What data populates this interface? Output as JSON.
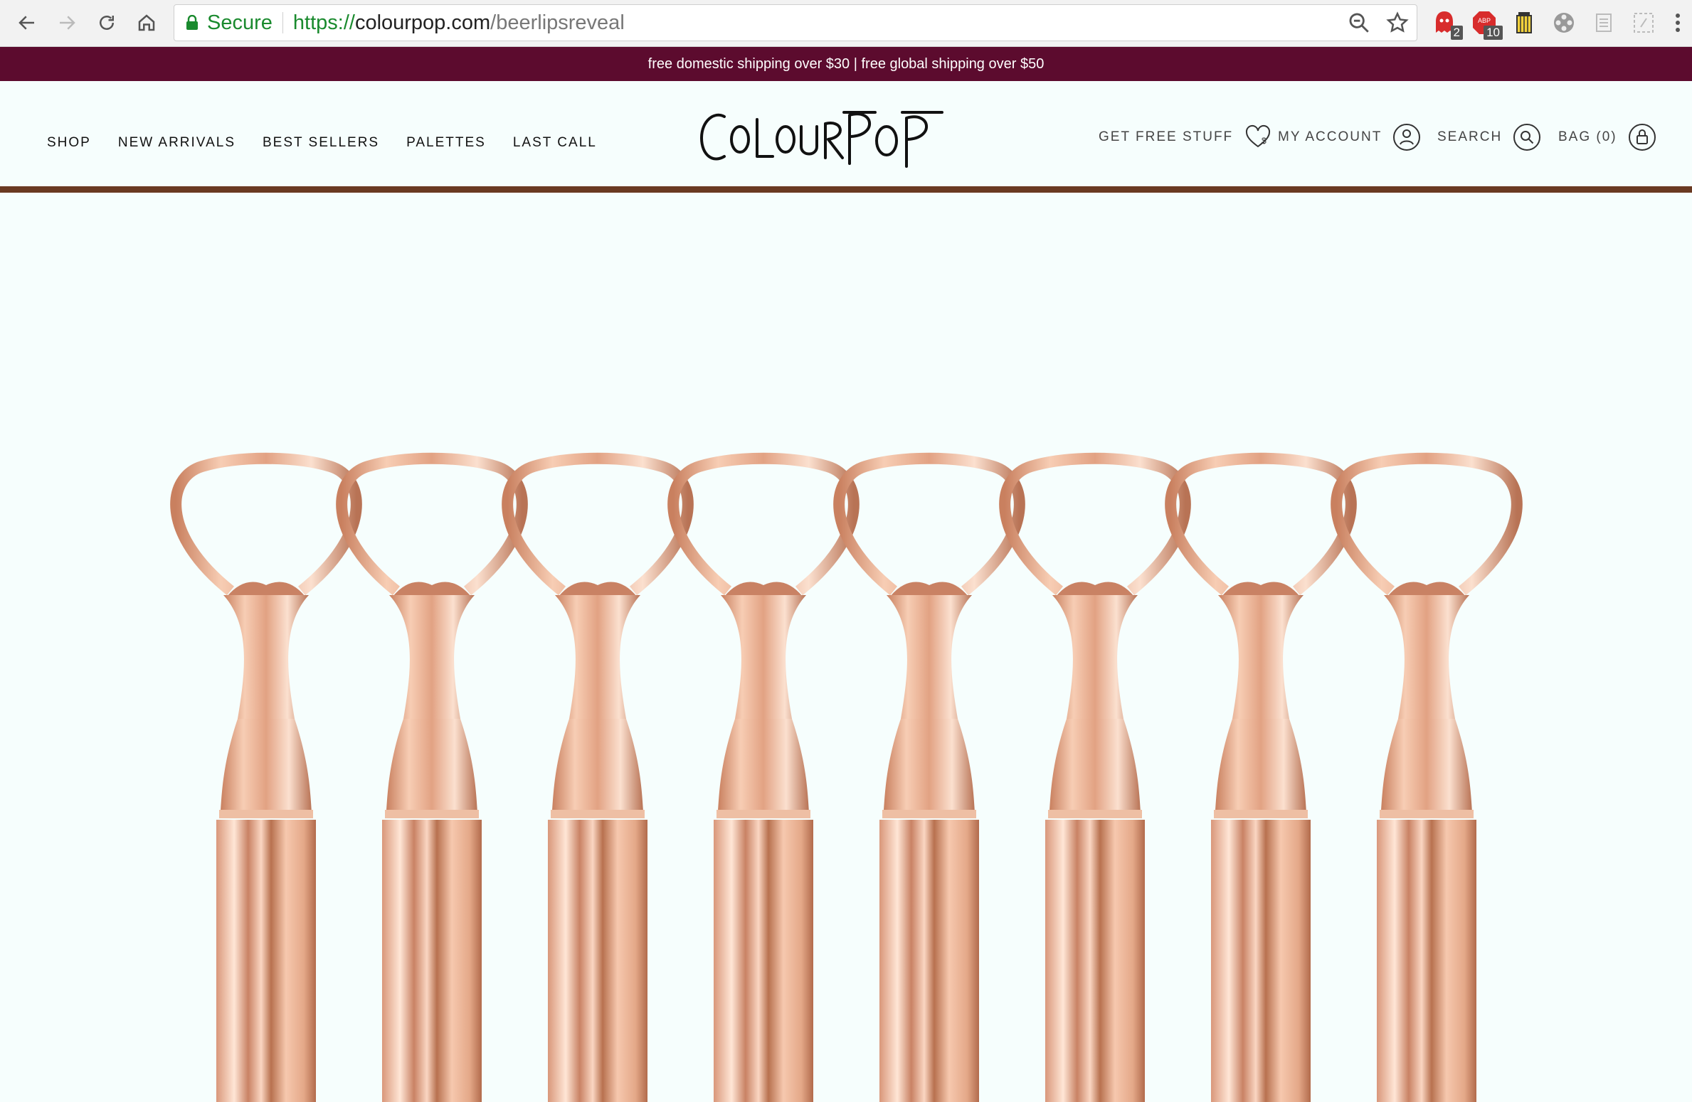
{
  "browser": {
    "secure_label": "Secure",
    "url_scheme": "https://",
    "url_host": "colourpop.com",
    "url_path": "/beerlipsreveal",
    "extensions": [
      {
        "name": "ghostery-icon",
        "badge": "2"
      },
      {
        "name": "adblock-icon",
        "badge": "10"
      },
      {
        "name": "honey-icon",
        "badge": ""
      },
      {
        "name": "film-reel-icon",
        "badge": ""
      },
      {
        "name": "notes-icon",
        "badge": ""
      },
      {
        "name": "dashed-box-icon",
        "badge": ""
      }
    ]
  },
  "promo": {
    "text": "free domestic shipping over $30 | free global shipping over $50"
  },
  "header": {
    "logo_text": "ColourPop",
    "nav": [
      "SHOP",
      "NEW ARRIVALS",
      "BEST SELLERS",
      "PALETTES",
      "LAST CALL"
    ],
    "utility": {
      "free_stuff": "GET FREE STUFF",
      "account": "MY ACCOUNT",
      "search": "SEARCH",
      "bag": "BAG (0)"
    }
  },
  "colors": {
    "promo_bg": "#5c0b2e",
    "header_rule": "#6a3a22",
    "page_bg": "#f6fefd",
    "rose_gold": "#e7a98c",
    "secure_green": "#1a8a2e"
  },
  "hero": {
    "opener_count": 8
  }
}
